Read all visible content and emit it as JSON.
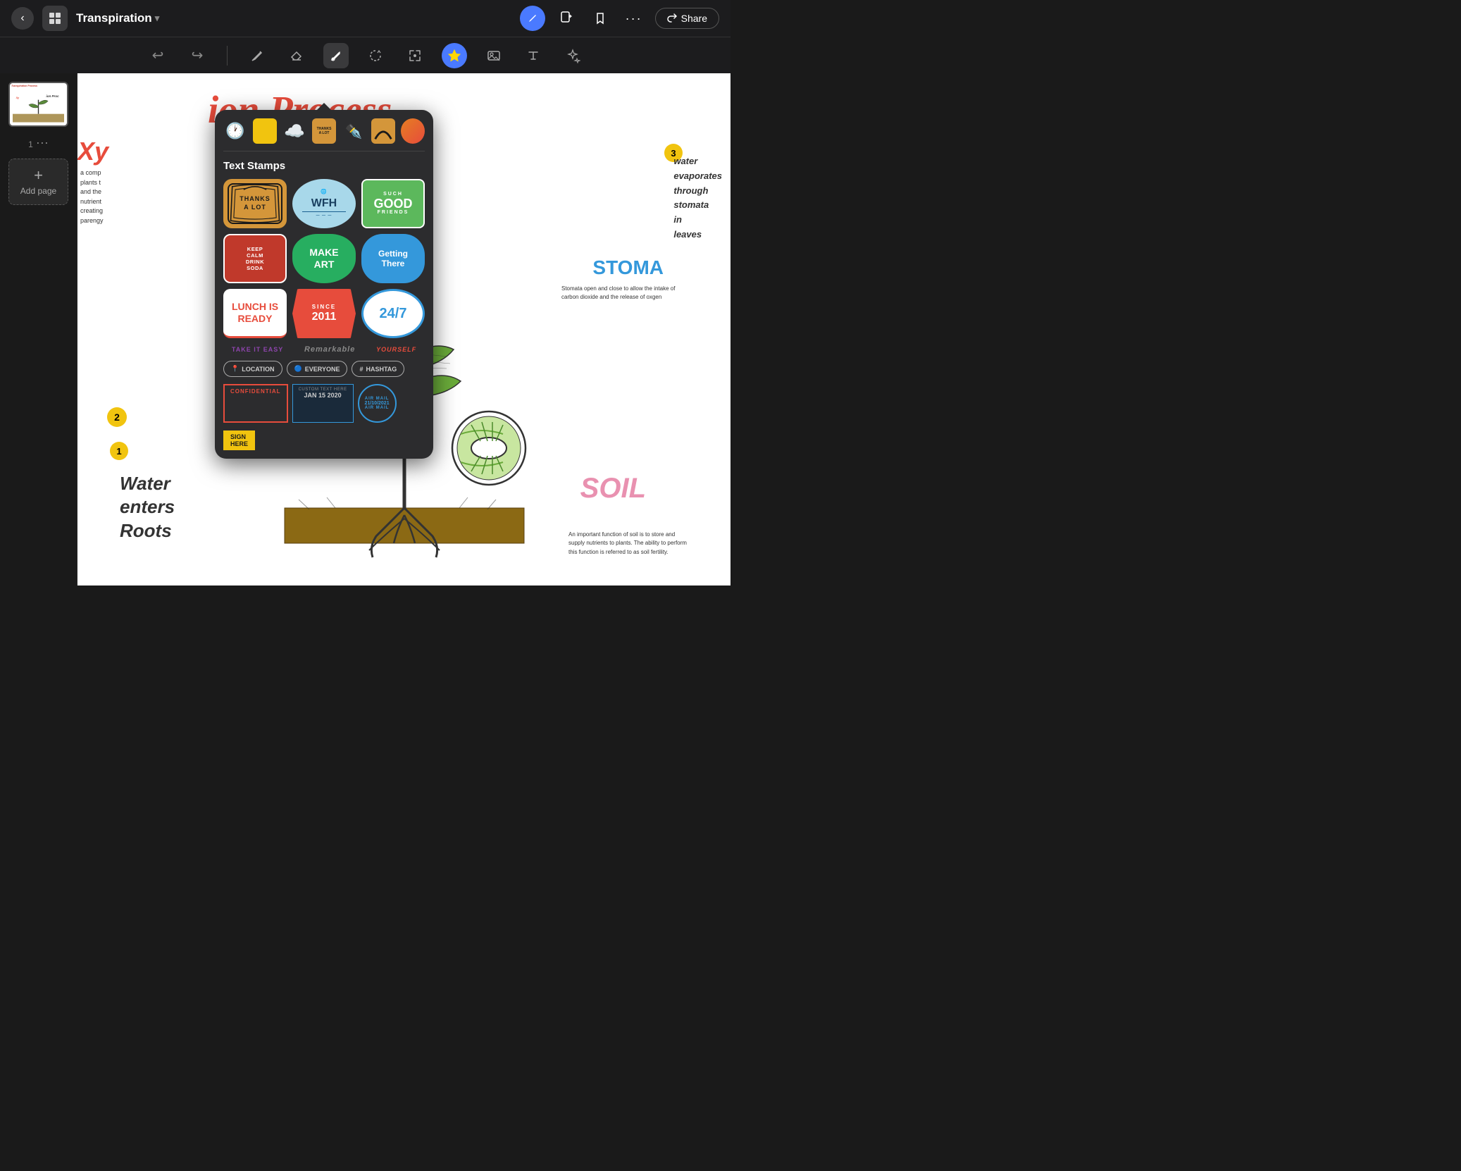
{
  "app": {
    "title": "Transpiration",
    "share_label": "Share"
  },
  "toolbar": {
    "undo_label": "↩",
    "redo_label": "↪",
    "pen_label": "pen",
    "eraser_label": "eraser",
    "pencil_label": "pencil",
    "lasso_label": "lasso",
    "selection_label": "selection",
    "sticker_label": "sticker",
    "image_label": "image",
    "text_label": "text",
    "magic_label": "magic"
  },
  "sidebar": {
    "page_number": "1",
    "add_page_label": "Add page"
  },
  "canvas": {
    "title": "ion Process",
    "title_full": "Transpiration Process",
    "xylem_label": "Xy",
    "xylem_desc": "a comp\nplants t\nand the\nnutrient\ncreating\nparengy",
    "water_enters": "Water\nenters\nRoots",
    "water_circle_num": "1",
    "stoma_label": "STOMA",
    "stoma_desc": "Stomata open and close to allow the intake of carbon dioxide and the release of oxgen",
    "water_evap": "water\nevaporates\nthrough\nstomata\nin\nleaves",
    "water_evap_num": "3",
    "soil_label": "SOIL",
    "soil_desc": "An important function of soil is to store and supply nutrients to plants. The ability to perform this function is referred to as soil fertility."
  },
  "sticker_popup": {
    "category_label": "Text Stamps",
    "stickers": [
      {
        "id": "thanks-a-lot",
        "label": "THANKS\nA LOT"
      },
      {
        "id": "wfh",
        "label": "WFH"
      },
      {
        "id": "good-friends",
        "such": "SUCH",
        "good": "GOOD",
        "friends": "FRIENDS"
      },
      {
        "id": "keep-calm",
        "label": "KEEP\nCALM\nDRINK\nSODA"
      },
      {
        "id": "make-art",
        "label": "MAKE\nART"
      },
      {
        "id": "getting-there",
        "label": "Getting\nThere"
      },
      {
        "id": "lunch-is-ready",
        "label": "LUNCH IS\nREADY"
      },
      {
        "id": "since-2011",
        "since": "SINCE",
        "year": "2011"
      },
      {
        "id": "24-7",
        "label": "24/7"
      }
    ],
    "text_stamps": [
      {
        "id": "take-it-easy",
        "label": "TAKE IT EASY"
      },
      {
        "id": "remarkable",
        "label": "Remarkable"
      },
      {
        "id": "yourself",
        "label": "YOURSELF"
      }
    ],
    "tag_stamps": [
      {
        "id": "location",
        "label": "LOCATION",
        "icon": "📍"
      },
      {
        "id": "everyone",
        "label": "EVERYONE",
        "icon": "🔵"
      },
      {
        "id": "hashtag",
        "label": "HASHTAG",
        "icon": "#"
      }
    ],
    "special_stamps": [
      {
        "id": "confidential",
        "label": "CONFIDENTIAL"
      },
      {
        "id": "custom-date",
        "label": "CUSTOM TEXT HERE\nJAN 15 2020"
      },
      {
        "id": "airmail",
        "label": "AIR MAIL\n21/10/2021\nAIR MAIL"
      },
      {
        "id": "sign-here",
        "label": "SIGN\nHERE"
      }
    ]
  }
}
